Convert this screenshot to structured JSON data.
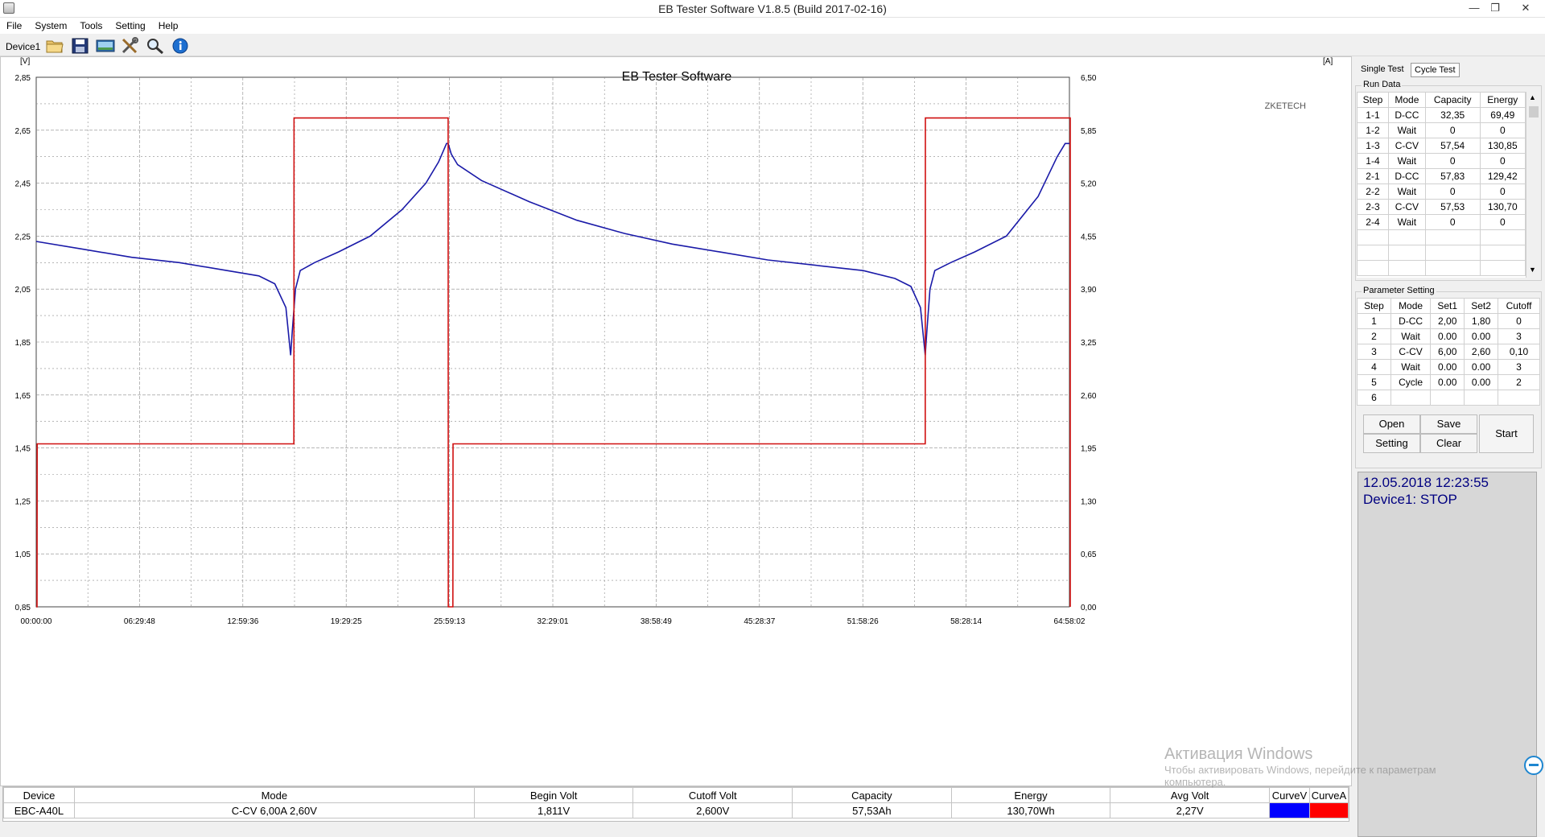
{
  "window": {
    "title": "EB Tester Software V1.8.5 (Build 2017-02-16)"
  },
  "menu": [
    "File",
    "System",
    "Tools",
    "Setting",
    "Help"
  ],
  "toolbar": {
    "device_label": "Device1"
  },
  "chart": {
    "title": "EB Tester Software",
    "brand": "ZKETECH",
    "left_unit": "[V]",
    "right_unit": "[A]",
    "left_ticks": [
      "2,85",
      "2,65",
      "2,45",
      "2,25",
      "2,05",
      "1,85",
      "1,65",
      "1,45",
      "1,25",
      "1,05",
      "0,85"
    ],
    "right_ticks": [
      "6,50",
      "5,85",
      "5,20",
      "4,55",
      "3,90",
      "3,25",
      "2,60",
      "1,95",
      "1,30",
      "0,65",
      "0,00"
    ],
    "x_ticks": [
      "00:00:00",
      "06:29:48",
      "12:59:36",
      "19:29:25",
      "25:59:13",
      "32:29:01",
      "38:58:49",
      "45:28:37",
      "51:58:26",
      "58:28:14",
      "64:58:02"
    ]
  },
  "chart_data": {
    "type": "line",
    "title": "EB Tester Software",
    "xlabel": "",
    "ylabel": "[V]",
    "y2label": "[A]",
    "x_unit": "hours",
    "xlim": [
      0,
      64.967
    ],
    "ylim": [
      0.85,
      2.85
    ],
    "y2lim": [
      0.0,
      6.5
    ],
    "grid": true,
    "series": [
      {
        "name": "CurveV",
        "color": "#1a1aa8",
        "axis": "left",
        "x": [
          0,
          3,
          6,
          9,
          12,
          14,
          15,
          15.7,
          16.0,
          16.1,
          16.3,
          16.6,
          17.5,
          19,
          21,
          23,
          24.5,
          25.3,
          25.8,
          25.9,
          26.1,
          26.5,
          28,
          31,
          34,
          37,
          40,
          43,
          46,
          49,
          52,
          54,
          55,
          55.6,
          55.9,
          56.0,
          56.2,
          56.5,
          57.5,
          59,
          61,
          63,
          64.2,
          64.7,
          64.97
        ],
        "y": [
          2.23,
          2.2,
          2.17,
          2.15,
          2.12,
          2.1,
          2.07,
          1.98,
          1.8,
          1.89,
          2.05,
          2.12,
          2.15,
          2.19,
          2.25,
          2.35,
          2.45,
          2.53,
          2.6,
          2.6,
          2.56,
          2.52,
          2.46,
          2.38,
          2.31,
          2.26,
          2.22,
          2.19,
          2.16,
          2.14,
          2.12,
          2.09,
          2.06,
          1.98,
          1.8,
          1.89,
          2.05,
          2.12,
          2.15,
          2.19,
          2.25,
          2.4,
          2.55,
          2.6,
          2.6
        ]
      },
      {
        "name": "CurveA",
        "color": "#d01010",
        "axis": "right",
        "x": [
          0,
          0.05,
          0.06,
          16.2,
          16.21,
          25.9,
          25.91,
          26.2,
          26.21,
          55.9,
          55.91,
          65.6,
          65.61
        ],
        "y": [
          0,
          0,
          2.0,
          2.0,
          6.0,
          6.0,
          0,
          0,
          2.0,
          2.0,
          6.0,
          6.0,
          0
        ]
      }
    ]
  },
  "right": {
    "tabs": [
      "Single Test",
      "Cycle Test"
    ],
    "run_data": {
      "label": "Run Data",
      "headers": [
        "Step",
        "Mode",
        "Capacity",
        "Energy"
      ],
      "rows": [
        [
          "1-1",
          "D-CC",
          "32,35",
          "69,49"
        ],
        [
          "1-2",
          "Wait",
          "0",
          "0"
        ],
        [
          "1-3",
          "C-CV",
          "57,54",
          "130,85"
        ],
        [
          "1-4",
          "Wait",
          "0",
          "0"
        ],
        [
          "2-1",
          "D-CC",
          "57,83",
          "129,42"
        ],
        [
          "2-2",
          "Wait",
          "0",
          "0"
        ],
        [
          "2-3",
          "C-CV",
          "57,53",
          "130,70"
        ],
        [
          "2-4",
          "Wait",
          "0",
          "0"
        ]
      ]
    },
    "param": {
      "label": "Parameter Setting",
      "headers": [
        "Step",
        "Mode",
        "Set1",
        "Set2",
        "Cutoff"
      ],
      "rows": [
        [
          "1",
          "D-CC",
          "2,00",
          "1,80",
          "0"
        ],
        [
          "2",
          "Wait",
          "0.00",
          "0.00",
          "3"
        ],
        [
          "3",
          "C-CV",
          "6,00",
          "2,60",
          "0,10"
        ],
        [
          "4",
          "Wait",
          "0.00",
          "0.00",
          "3"
        ],
        [
          "5",
          "Cycle",
          "0.00",
          "0.00",
          "2"
        ],
        [
          "6",
          "",
          "",
          "",
          ""
        ]
      ]
    },
    "buttons": {
      "open": "Open",
      "save": "Save",
      "setting": "Setting",
      "clear": "Clear",
      "start": "Start"
    },
    "status": {
      "datetime": "12.05.2018 12:23:55",
      "device": "Device1: STOP"
    }
  },
  "bottom": {
    "headers": [
      "Device",
      "Mode",
      "Begin Volt",
      "Cutoff Volt",
      "Capacity",
      "Energy",
      "Avg Volt",
      "CurveV",
      "CurveA"
    ],
    "values": [
      "EBC-A40L",
      "C-CV  6,00A  2,60V",
      "1,811V",
      "2,600V",
      "57,53Ah",
      "130,70Wh",
      "2,27V",
      "",
      ""
    ],
    "curve_colors": {
      "v": "#0000ff",
      "a": "#ff0000"
    }
  },
  "watermark": {
    "line1": "Активация Windows",
    "line2": "Чтобы активировать Windows, перейдите к параметрам",
    "line3": "компьютера."
  }
}
